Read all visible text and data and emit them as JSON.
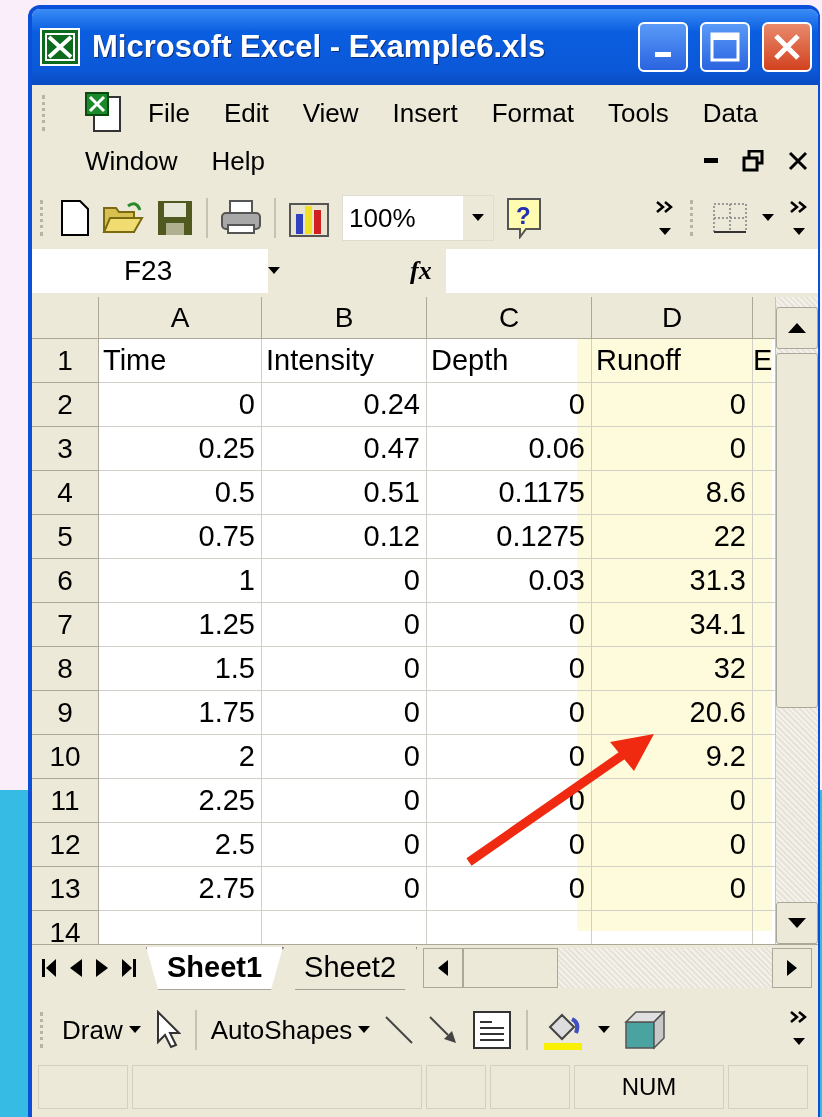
{
  "window": {
    "title": "Microsoft Excel - Example6.xls"
  },
  "menu_rows": [
    [
      "File",
      "Edit",
      "View",
      "Insert",
      "Format",
      "Tools",
      "Data"
    ],
    [
      "Window",
      "Help"
    ]
  ],
  "toolbar": {
    "zoom": "100%",
    "help_glyph": "?"
  },
  "formula_bar": {
    "name_box": "F23",
    "function_label": "fx"
  },
  "sheet": {
    "columns": [
      "A",
      "B",
      "C",
      "D"
    ],
    "rows": [
      {
        "header": "1",
        "cells": [
          "Time",
          "Intensity",
          "Depth",
          "Runoff",
          "E"
        ]
      },
      {
        "header": "2",
        "cells": [
          "0",
          "0.24",
          "0",
          "0"
        ]
      },
      {
        "header": "3",
        "cells": [
          "0.25",
          "0.47",
          "0.06",
          "0"
        ]
      },
      {
        "header": "4",
        "cells": [
          "0.5",
          "0.51",
          "0.1175",
          "8.6"
        ]
      },
      {
        "header": "5",
        "cells": [
          "0.75",
          "0.12",
          "0.1275",
          "22"
        ]
      },
      {
        "header": "6",
        "cells": [
          "1",
          "0",
          "0.03",
          "31.3"
        ]
      },
      {
        "header": "7",
        "cells": [
          "1.25",
          "0",
          "0",
          "34.1"
        ]
      },
      {
        "header": "8",
        "cells": [
          "1.5",
          "0",
          "0",
          "32"
        ]
      },
      {
        "header": "9",
        "cells": [
          "1.75",
          "0",
          "0",
          "20.6"
        ]
      },
      {
        "header": "10",
        "cells": [
          "2",
          "0",
          "0",
          "9.2"
        ]
      },
      {
        "header": "11",
        "cells": [
          "2.25",
          "0",
          "0",
          "0"
        ]
      },
      {
        "header": "12",
        "cells": [
          "2.5",
          "0",
          "0",
          "0"
        ]
      },
      {
        "header": "13",
        "cells": [
          "2.75",
          "0",
          "0",
          "0"
        ]
      },
      {
        "header": "14"
      }
    ]
  },
  "sheet_tabs": [
    {
      "label": "Sheet1",
      "selected": true
    },
    {
      "label": "Sheet2",
      "selected": false
    }
  ],
  "drawing_toolbar": {
    "draw": "Draw",
    "autoshapes": "AutoShapes"
  },
  "status_bar": {
    "indicator": "NUM"
  }
}
